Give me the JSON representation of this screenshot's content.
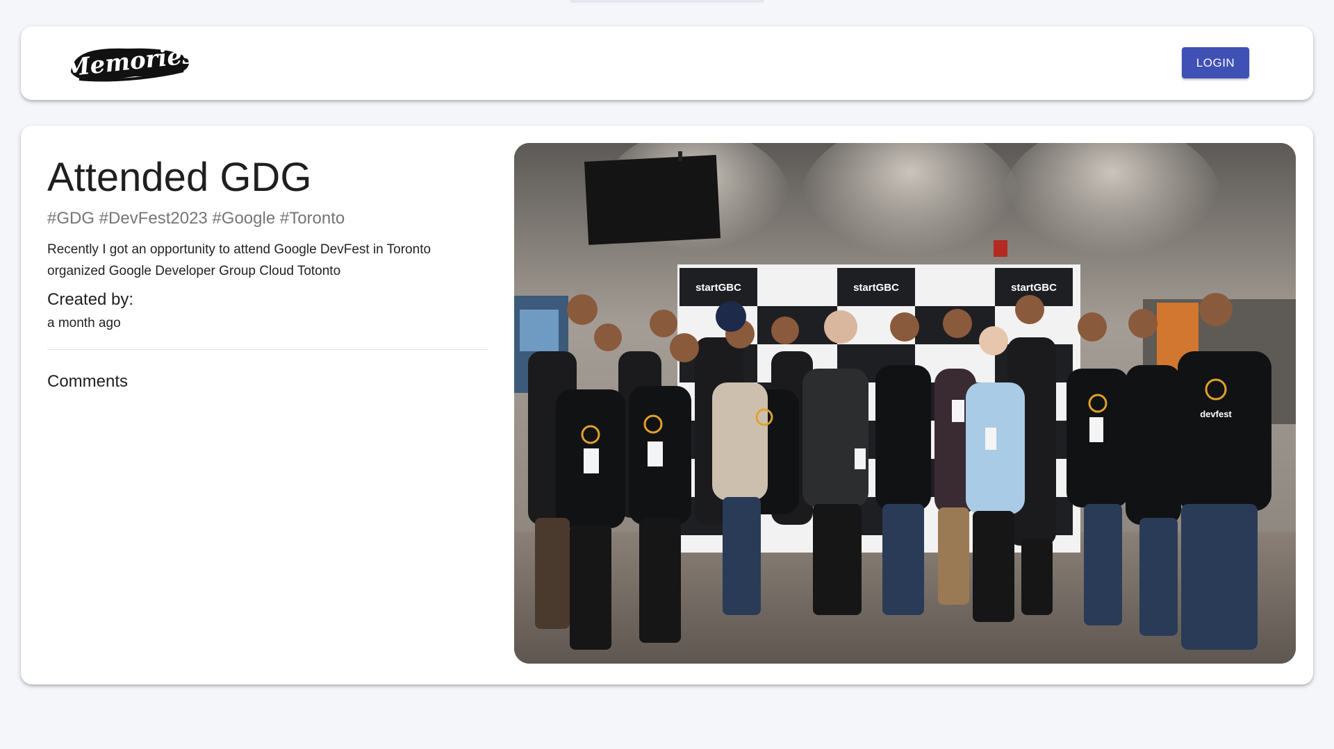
{
  "header": {
    "logo_text": "Memories",
    "login_label": "LOGIN"
  },
  "post": {
    "title": "Attended GDG",
    "tags": "#GDG #DevFest2023 #Google #Toronto",
    "message": "Recently I got an opportunity to attend Google DevFest in Toronto organized Google Developer Group Cloud Totonto",
    "created_label": "Created by:",
    "created_time": "a month ago",
    "comments_label": "Comments"
  },
  "photo": {
    "backdrop_texts": [
      "startGBC",
      "startGBC",
      "startGBC"
    ],
    "shirt_text": "devfest"
  },
  "colors": {
    "accent": "#3f51b5",
    "background": "#f5f6fa"
  }
}
